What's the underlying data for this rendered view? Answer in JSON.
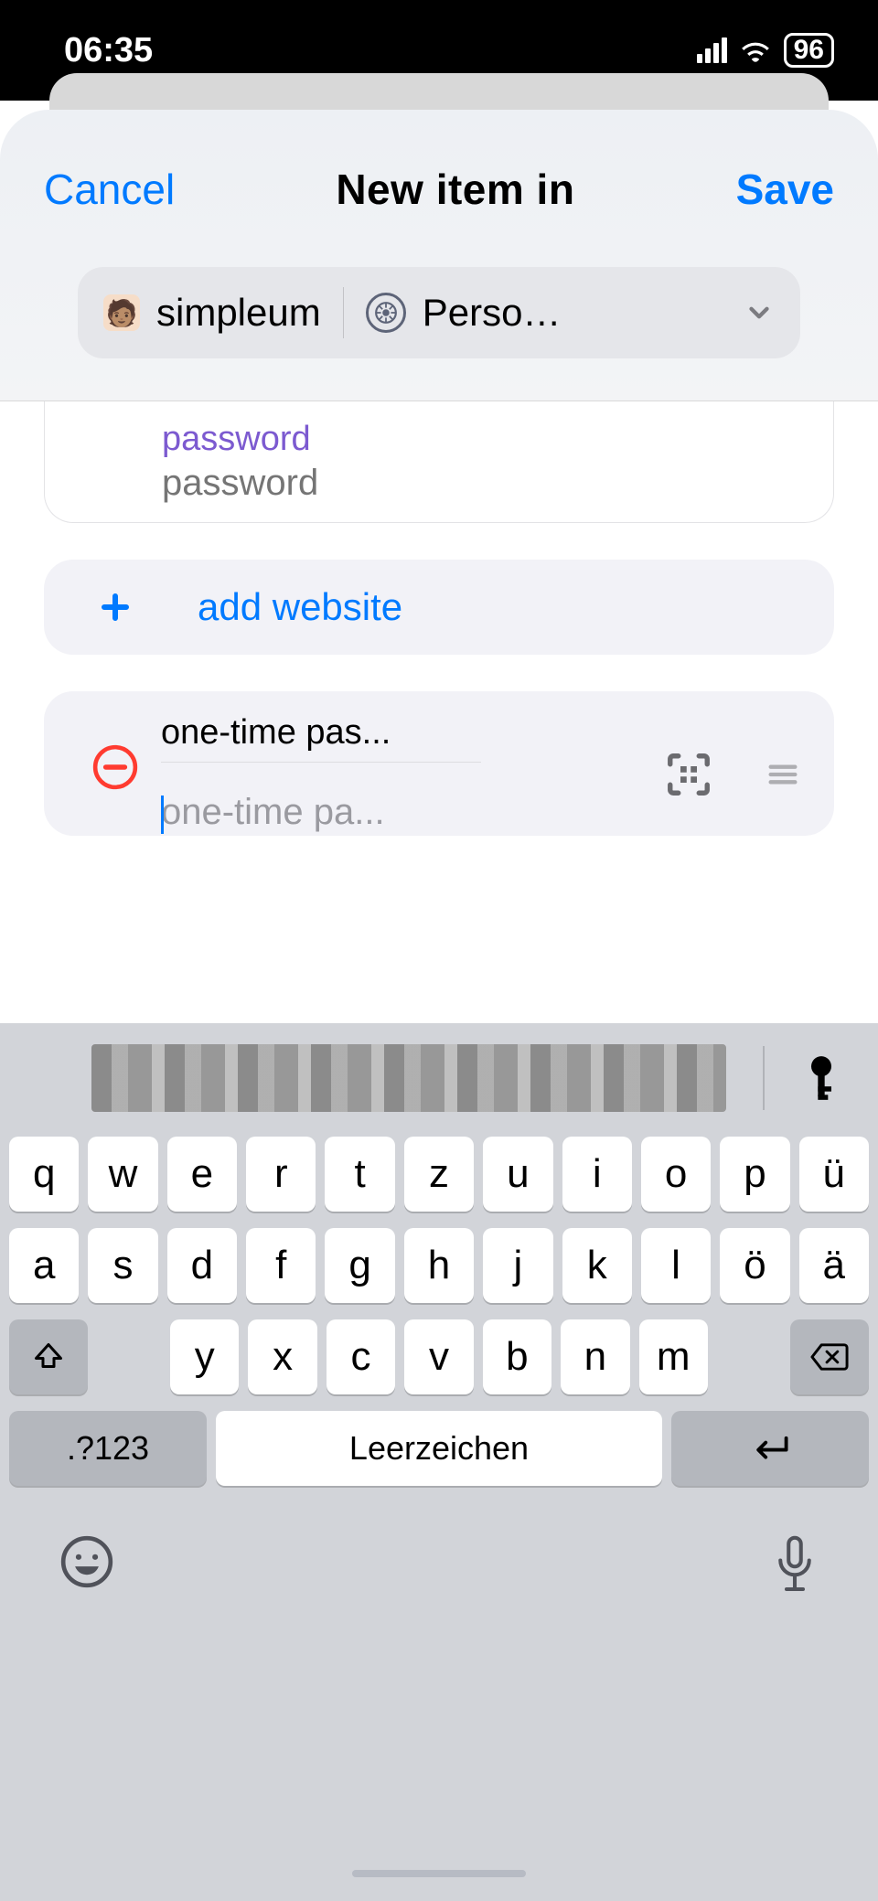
{
  "status": {
    "time": "06:35",
    "battery": "96"
  },
  "nav": {
    "cancel": "Cancel",
    "title": "New item in",
    "save": "Save"
  },
  "collection": {
    "account_avatar": "🧑🏽",
    "account_name": "simpleum",
    "vault_name": "Perso…"
  },
  "form": {
    "password": {
      "label": "password",
      "placeholder": "password",
      "value": ""
    },
    "add_website": "add website",
    "otp": {
      "label": "one-time pas...",
      "placeholder": "one-time pa...",
      "value": ""
    }
  },
  "keyboard": {
    "row1": [
      "q",
      "w",
      "e",
      "r",
      "t",
      "z",
      "u",
      "i",
      "o",
      "p",
      "ü"
    ],
    "row2": [
      "a",
      "s",
      "d",
      "f",
      "g",
      "h",
      "j",
      "k",
      "l",
      "ö",
      "ä"
    ],
    "row3": [
      "y",
      "x",
      "c",
      "v",
      "b",
      "n",
      "m"
    ],
    "numbers_label": ".?123",
    "space_label": "Leerzeichen"
  }
}
